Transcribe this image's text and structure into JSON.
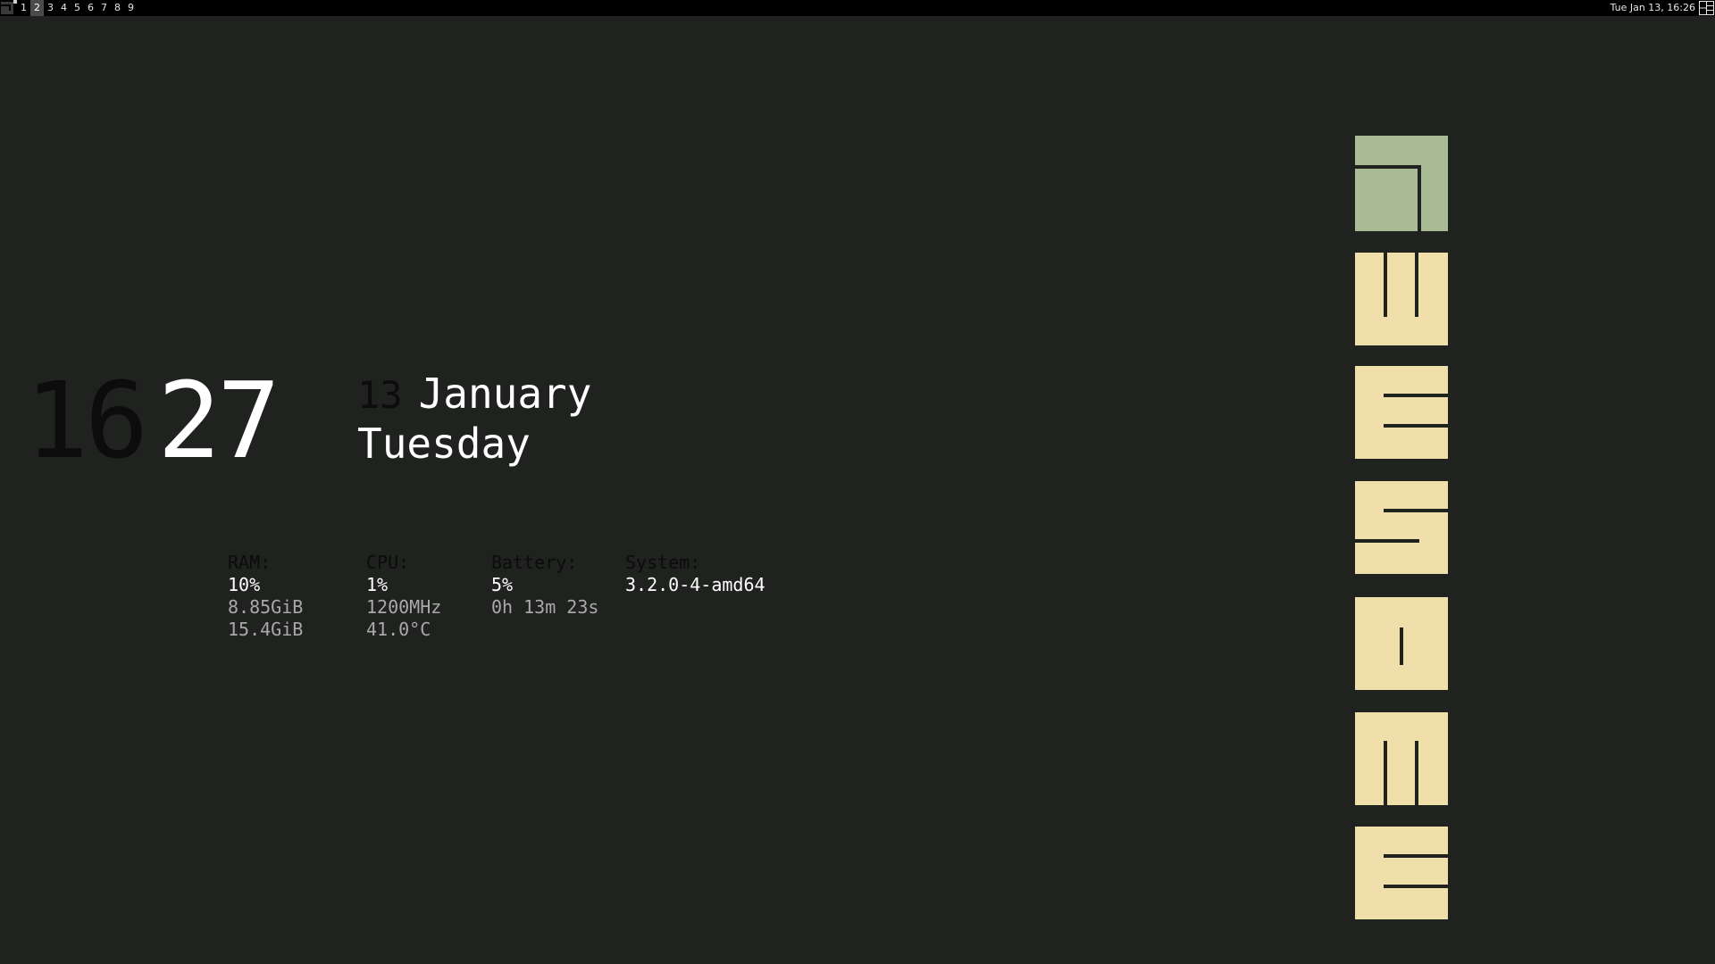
{
  "topbar": {
    "tags": [
      "1",
      "2",
      "3",
      "4",
      "5",
      "6",
      "7",
      "8",
      "9"
    ],
    "active_tag_index": 1,
    "clock": "Tue Jan 13, 16:26",
    "icons": [
      "awesome-launcher-icon",
      "tile-layout-icon"
    ]
  },
  "clock": {
    "hours": "16",
    "minutes": "27"
  },
  "date": {
    "day": "13",
    "month": "January",
    "weekday": "Tuesday"
  },
  "stats": {
    "ram": {
      "label": "RAM:",
      "percent": "10%",
      "used": "8.85GiB",
      "total": "15.4GiB"
    },
    "cpu": {
      "label": "CPU:",
      "percent": "1%",
      "freq": "1200MHz",
      "temp": "41.0°C"
    },
    "battery": {
      "label": "Battery:",
      "percent": "5%",
      "remaining": "0h 13m 23s"
    },
    "system": {
      "label": "System:",
      "kernel": "3.2.0-4-amd64"
    }
  },
  "logo": {
    "letters": [
      "a",
      "w",
      "e",
      "s",
      "o",
      "m",
      "e"
    ],
    "first_tile_color": "#a9bb94",
    "tile_color": "#f0dfab",
    "stroke_color": "#1f221f"
  }
}
